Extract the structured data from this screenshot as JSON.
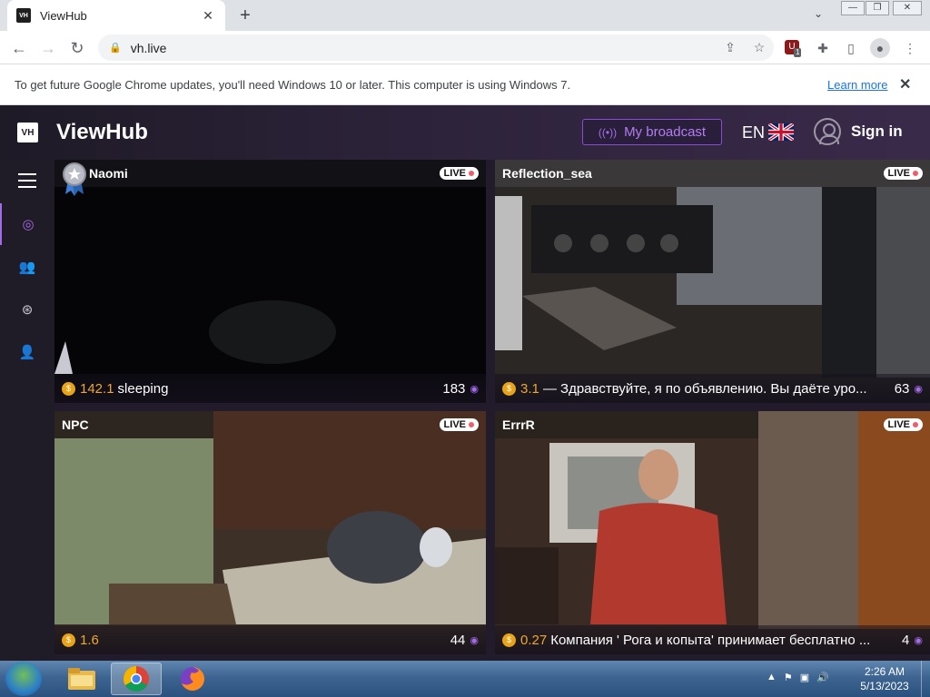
{
  "browser": {
    "tab": {
      "favicon": "VH",
      "title": "ViewHub"
    },
    "url": "vh.live",
    "extension_badge": "1",
    "window_controls": {
      "minimize": "—",
      "maximize": "❐",
      "close": "✕"
    }
  },
  "infobar": {
    "text": "To get future Google Chrome updates, you'll need Windows 10 or later. This computer is using Windows 7.",
    "learn_more": "Learn more"
  },
  "site": {
    "logo_mark": "VH",
    "logo_text": "ViewHub",
    "broadcast_label": "My broadcast",
    "language": "EN",
    "signin_label": "Sign in",
    "accent_color": "#a46be8",
    "sidebar": {
      "items": [
        {
          "icon": "webcam-icon",
          "active": true
        },
        {
          "icon": "users-icon",
          "active": false
        },
        {
          "icon": "cam-heart-icon",
          "active": false
        },
        {
          "icon": "user-settings-icon",
          "active": false
        }
      ]
    },
    "streams": [
      {
        "name": "Naomi",
        "live": "LIVE",
        "tokens": "142.1",
        "topic": "sleeping",
        "viewers": "183",
        "badge": "medal-icon"
      },
      {
        "name": "Reflection_sea",
        "live": "LIVE",
        "tokens": "3.1",
        "topic": "— Здравствуйте, я по объявлению. Вы даёте уро...",
        "viewers": "63"
      },
      {
        "name": "NPC",
        "live": "LIVE",
        "tokens": "1.6",
        "topic": "",
        "viewers": "44"
      },
      {
        "name": "ErrrR",
        "live": "LIVE",
        "tokens": "0.27",
        "topic": "Компания ' Рога и копыта' принимает бесплатно ...",
        "viewers": "4"
      }
    ]
  },
  "taskbar": {
    "apps": [
      "explorer-icon",
      "chrome-icon",
      "firefox-icon"
    ],
    "time": "2:26 AM",
    "date": "5/13/2023"
  }
}
